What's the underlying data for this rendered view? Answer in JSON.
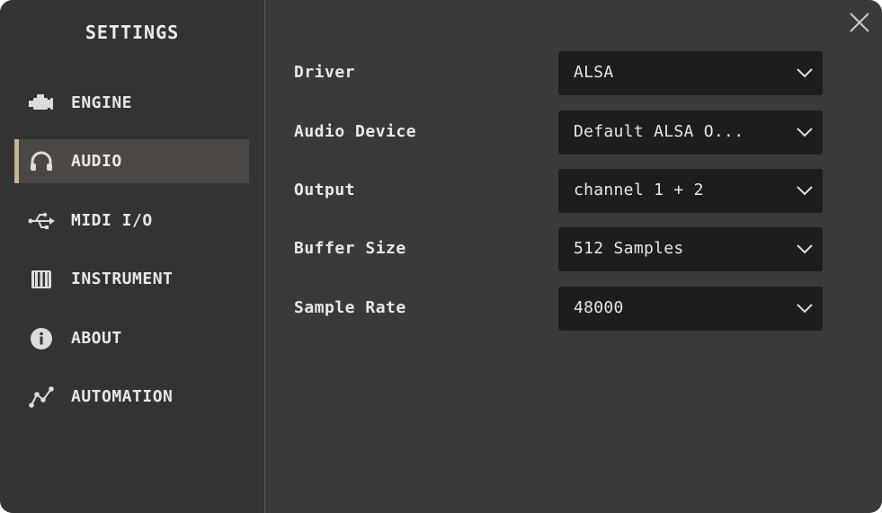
{
  "sidebar": {
    "title": "SETTINGS",
    "accent_color": "#c9b58f",
    "items": [
      {
        "label": "ENGINE",
        "icon": "engine-icon",
        "active": false
      },
      {
        "label": "AUDIO",
        "icon": "headphones-icon",
        "active": true
      },
      {
        "label": "MIDI I/O",
        "icon": "usb-icon",
        "active": false
      },
      {
        "label": "INSTRUMENT",
        "icon": "piano-icon",
        "active": false
      },
      {
        "label": "ABOUT",
        "icon": "info-icon",
        "active": false
      },
      {
        "label": "AUTOMATION",
        "icon": "automation-curve-icon",
        "active": false
      }
    ]
  },
  "close_icon": "close-icon",
  "settings": {
    "rows": [
      {
        "label": "Driver",
        "value": "ALSA"
      },
      {
        "label": "Audio Device",
        "value": "Default ALSA O..."
      },
      {
        "label": "Output",
        "value": "channel 1 + 2"
      },
      {
        "label": "Buffer Size",
        "value": "512 Samples"
      },
      {
        "label": "Sample Rate",
        "value": "48000"
      }
    ]
  }
}
